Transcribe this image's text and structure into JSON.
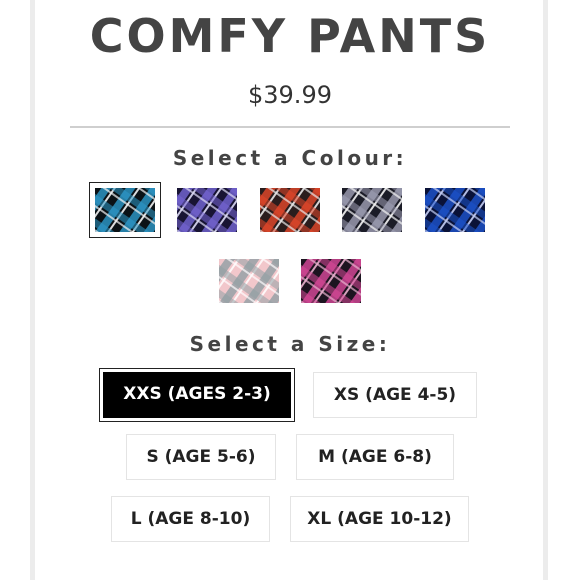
{
  "product": {
    "title": "COMFY PANTS",
    "price": "$39.99"
  },
  "colour": {
    "label": "Select a Colour:",
    "swatches": [
      {
        "name": "blue-black plaid",
        "colors": [
          "#0b1216",
          "#2fa3d6",
          "#ffffff"
        ],
        "selected": true
      },
      {
        "name": "purple plaid",
        "colors": [
          "#181433",
          "#7b6cde",
          "#e8e6ff"
        ],
        "selected": false
      },
      {
        "name": "red-black plaid",
        "colors": [
          "#2a1d1d",
          "#ef4a2b",
          "#f2f2f2"
        ],
        "selected": false
      },
      {
        "name": "grey-black plaid",
        "colors": [
          "#1b1c27",
          "#a7a8bd",
          "#ffffff"
        ],
        "selected": false
      },
      {
        "name": "royal blue plaid",
        "colors": [
          "#0a1238",
          "#1e57d6",
          "#cfd8ff"
        ],
        "selected": false
      },
      {
        "name": "pink-grey plaid",
        "colors": [
          "#f2c7cb",
          "#8d9ea3",
          "#ffffff"
        ],
        "selected": false
      },
      {
        "name": "pink-black plaid",
        "colors": [
          "#1d1420",
          "#e44ca1",
          "#f4b9d7"
        ],
        "selected": false
      }
    ]
  },
  "size": {
    "label": "Select a Size:",
    "options": [
      {
        "label": "XXS (AGES 2-3)",
        "selected": true
      },
      {
        "label": "XS (AGE 4-5)",
        "selected": false
      },
      {
        "label": "S (AGE 5-6)",
        "selected": false
      },
      {
        "label": "M (AGE 6-8)",
        "selected": false
      },
      {
        "label": "L (AGE 8-10)",
        "selected": false
      },
      {
        "label": "XL (AGE 10-12)",
        "selected": false
      }
    ]
  }
}
